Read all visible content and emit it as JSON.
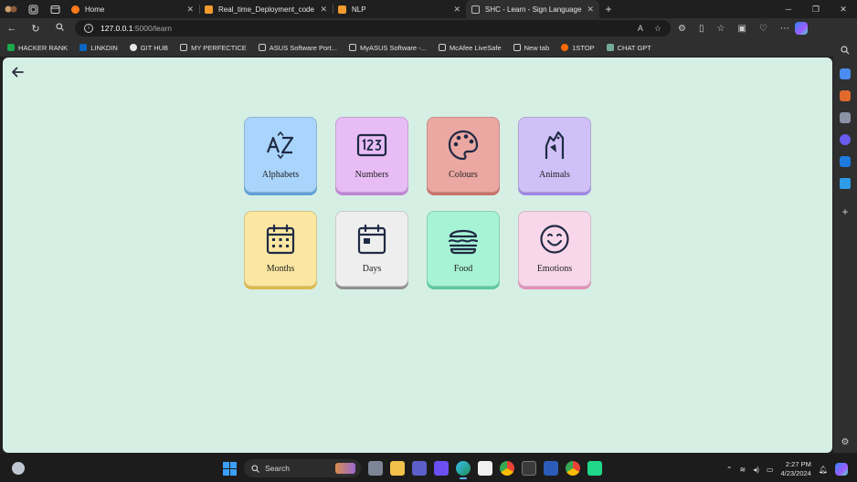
{
  "browser": {
    "tabs": [
      {
        "title": "Home",
        "icon_color": "#ff7a1a",
        "active": false
      },
      {
        "title": "Real_time_Deployment_code",
        "icon_color": "#f29a2e",
        "active": false
      },
      {
        "title": "NLP",
        "icon_color": "#f29a2e",
        "active": false
      },
      {
        "title": "SHC - Learn - Sign Language",
        "icon_color": "#bdbdbd",
        "active": true
      }
    ],
    "address": {
      "host": "127.0.0.1",
      "path": ":5000/learn"
    },
    "bookmarks": [
      {
        "label": "HACKER RANK",
        "icon_color": "#1ba94c"
      },
      {
        "label": "LINKDIN",
        "icon_color": "#0a66c2"
      },
      {
        "label": "GIT HUB",
        "icon_color": "#e6e6e6"
      },
      {
        "label": "MY PERFECTICE",
        "icon_color": "#8e8e8e"
      },
      {
        "label": "ASUS Software Port...",
        "icon_color": "#8e8e8e"
      },
      {
        "label": "MyASUS Software -...",
        "icon_color": "#8e8e8e"
      },
      {
        "label": "McAfee LiveSafe",
        "icon_color": "#8e8e8e"
      },
      {
        "label": "New tab",
        "icon_color": "#8e8e8e"
      },
      {
        "label": "1STOP",
        "icon_color": "#ff6a00"
      },
      {
        "label": "CHAT GPT",
        "icon_color": "#74aa9c"
      }
    ]
  },
  "learn": {
    "categories": [
      {
        "label": "Alphabets",
        "icon": "az-icon",
        "color": "#a9d4fb",
        "shade": "#5e9fdc"
      },
      {
        "label": "Numbers",
        "icon": "numbers-123-icon",
        "color": "#e8bdf5",
        "shade": "#c085d7"
      },
      {
        "label": "Colours",
        "icon": "palette-icon",
        "color": "#eba7a2",
        "shade": "#c9726b"
      },
      {
        "label": "Animals",
        "icon": "animal-icon",
        "color": "#cfc1f7",
        "shade": "#9d86e6"
      },
      {
        "label": "Months",
        "icon": "calendar-grid-icon",
        "color": "#fbe7a1",
        "shade": "#dfb94a"
      },
      {
        "label": "Days",
        "icon": "calendar-day-icon",
        "color": "#eeeeee",
        "shade": "#8f8f8f"
      },
      {
        "label": "Food",
        "icon": "burger-icon",
        "color": "#a6f3d5",
        "shade": "#5bc99f"
      },
      {
        "label": "Emotions",
        "icon": "smile-icon",
        "color": "#f9d7ea",
        "shade": "#e38fbb"
      }
    ]
  },
  "taskbar": {
    "search_placeholder": "Search",
    "time": "2:27 PM",
    "date": "4/23/2024"
  }
}
